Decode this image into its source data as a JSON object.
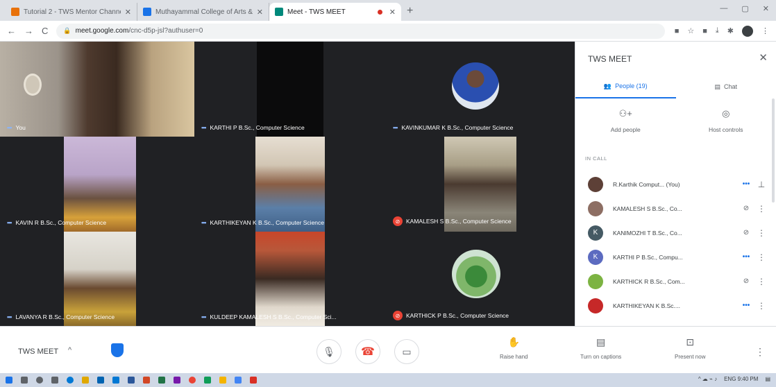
{
  "browser": {
    "tabs": [
      {
        "title": "Tutorial 2 - TWS Mentor Channel",
        "active": false,
        "favicon_color": "#e8710a"
      },
      {
        "title": "Muthayammal College of Arts & Sc",
        "active": false,
        "favicon_color": "#1a73e8"
      },
      {
        "title": "Meet - TWS MEET",
        "active": true,
        "favicon_color": "#00897b"
      }
    ],
    "url_host": "meet.google.com",
    "url_path": "/cnc-d5p-jsl?authuser=0"
  },
  "meeting": {
    "title": "TWS MEET",
    "tiles": [
      {
        "name": "You",
        "status": "dots"
      },
      {
        "name": "KARTHI P B.Sc., Computer Science",
        "status": "dots"
      },
      {
        "name": "KAVINKUMAR K B.Sc., Computer Science",
        "status": "dots"
      },
      {
        "name": "KAVIN R B.Sc., Computer Science",
        "status": "dots"
      },
      {
        "name": "KARTHIKEYAN K B.Sc., Computer Science",
        "status": "dots"
      },
      {
        "name": "KAMALESH S B.Sc., Computer Science",
        "status": "muted"
      },
      {
        "name": "LAVANYA R B.Sc., Computer Science",
        "status": "dots"
      },
      {
        "name": "KULDEEP KAMALESH S B.Sc., Computer Sci...",
        "status": "dots"
      },
      {
        "name": "KARTHICK P B.Sc., Computer Science",
        "status": "muted"
      }
    ]
  },
  "panel": {
    "title": "TWS MEET",
    "tab_people": "People (19)",
    "tab_chat": "Chat",
    "add_people": "Add people",
    "host_controls": "Host controls",
    "in_call_label": "IN CALL",
    "participants": [
      {
        "name": "R.Karthik Comput... (You)",
        "status": "dots",
        "action": "pin",
        "avatar_color": "#5d4037",
        "initial": ""
      },
      {
        "name": "KAMALESH S B.Sc., Co...",
        "status": "mic-off",
        "action": "more",
        "avatar_color": "#8d6e63",
        "initial": ""
      },
      {
        "name": "KANIMOZHI T B.Sc., Co...",
        "status": "mic-off",
        "action": "more",
        "avatar_color": "#455a64",
        "initial": "K"
      },
      {
        "name": "KARTHI P B.Sc., Compu...",
        "status": "dots",
        "action": "more",
        "avatar_color": "#5c6bc0",
        "initial": "K"
      },
      {
        "name": "KARTHICK R B.Sc., Com...",
        "status": "mic-off",
        "action": "more",
        "avatar_color": "#7cb342",
        "initial": ""
      },
      {
        "name": "KARTHIKEYAN K B.Sc....",
        "status": "dots",
        "action": "more",
        "avatar_color": "#c62828",
        "initial": ""
      }
    ]
  },
  "controls": {
    "raise_hand": "Raise hand",
    "captions": "Turn on captions",
    "present": "Present now"
  },
  "taskbar": {
    "tray_text": "ENG 9:40 PM"
  }
}
